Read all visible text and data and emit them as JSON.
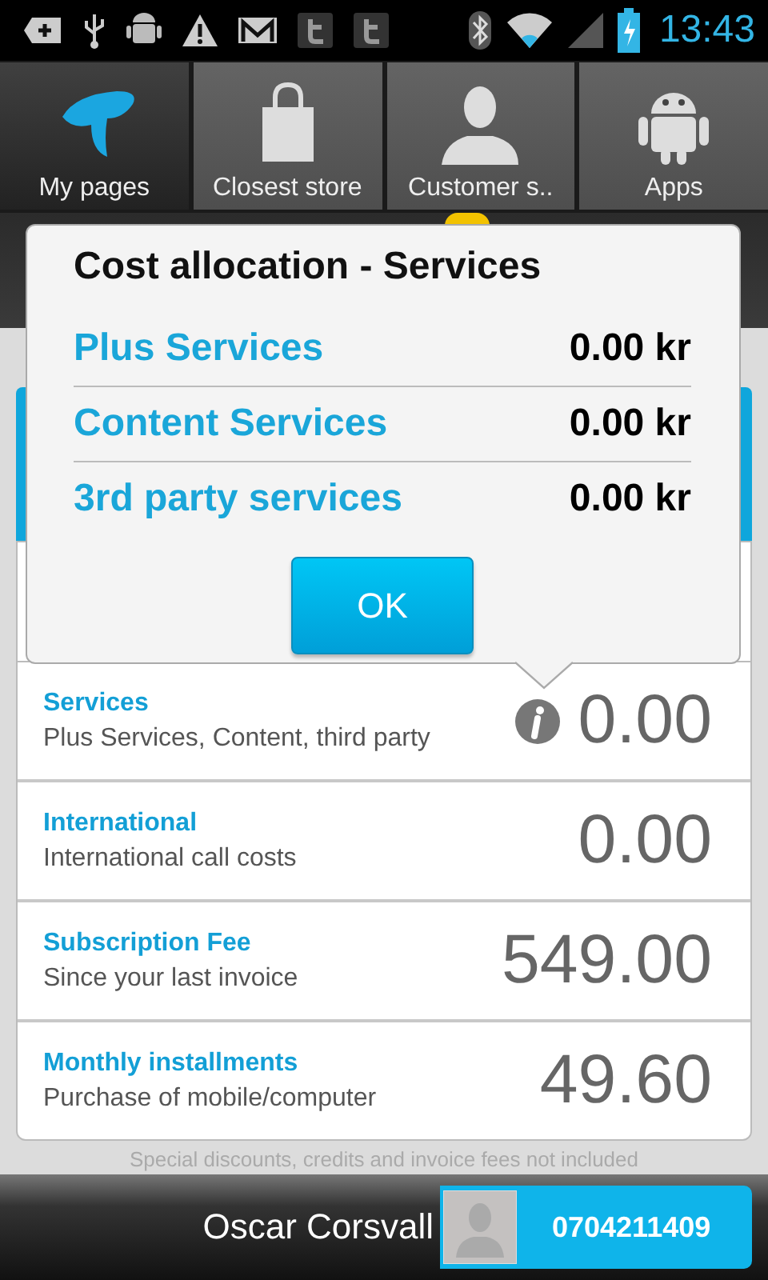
{
  "status_bar": {
    "time": "13:43"
  },
  "nav_tabs": [
    {
      "label": "My pages",
      "kind": "logo",
      "selected": true
    },
    {
      "label": "Closest store",
      "kind": "bag",
      "selected": false
    },
    {
      "label": "Customer s..",
      "kind": "person",
      "selected": false
    },
    {
      "label": "Apps",
      "kind": "android",
      "selected": false
    }
  ],
  "popup": {
    "title": "Cost allocation - Services",
    "items": [
      {
        "label": "Plus Services",
        "amount": "0.00 kr"
      },
      {
        "label": "Content Services",
        "amount": "0.00 kr"
      },
      {
        "label": "3rd party services",
        "amount": "0.00 kr"
      }
    ],
    "button": "OK"
  },
  "cost_rows": [
    {
      "title": "Services",
      "subtitle": "Plus Services, Content, third party",
      "amount": "0.00",
      "info": true
    },
    {
      "title": "International",
      "subtitle": "International call costs",
      "amount": "0.00",
      "info": false
    },
    {
      "title": "Subscription Fee",
      "subtitle": "Since your last invoice",
      "amount": "549.00",
      "info": false
    },
    {
      "title": "Monthly installments",
      "subtitle": "Purchase of mobile/computer",
      "amount": "49.60",
      "info": false
    }
  ],
  "footnote": "Special discounts, credits and invoice fees not included",
  "account": {
    "name": "Oscar Corsvall",
    "phone": "0704211409"
  }
}
